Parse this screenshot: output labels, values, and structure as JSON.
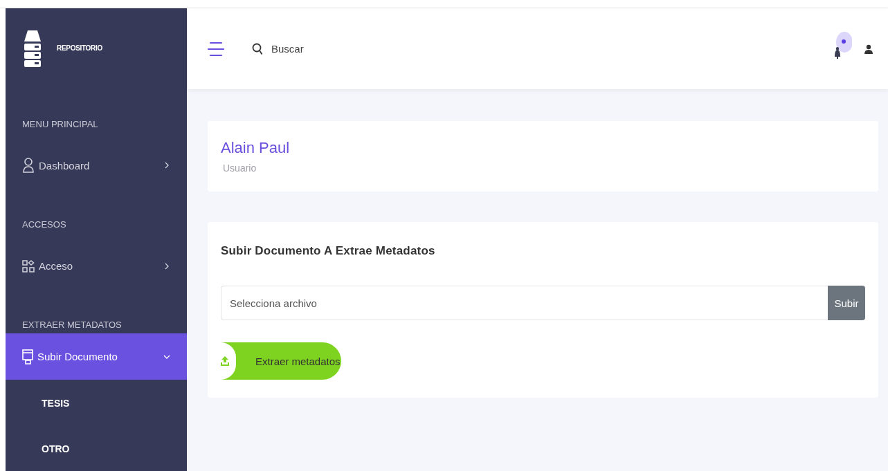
{
  "sidebar": {
    "brand": "REPOSITORIO",
    "sections": [
      {
        "title": "MENU PRINCIPAL",
        "items": [
          {
            "label": "Dashboard",
            "selected": false,
            "expanded": false
          }
        ]
      },
      {
        "title": "ACCESOS",
        "items": [
          {
            "label": "Acceso",
            "selected": false,
            "expanded": false
          }
        ]
      },
      {
        "title": "EXTRAER METADATOS",
        "items": [
          {
            "label": "Subir Documento",
            "selected": true,
            "expanded": true,
            "children": [
              {
                "label": "TESIS"
              },
              {
                "label": "OTRO"
              }
            ]
          }
        ]
      }
    ]
  },
  "header": {
    "search": {
      "placeholder": "Buscar"
    }
  },
  "profile": {
    "name": "Alain Paul",
    "role": "Usuario"
  },
  "upload": {
    "title": "Subir Documento A Extrae Metadatos",
    "file": {
      "placeholder": "Selecciona archivo"
    },
    "file_button": "Subir",
    "extract_button": "Extraer metadatos"
  }
}
